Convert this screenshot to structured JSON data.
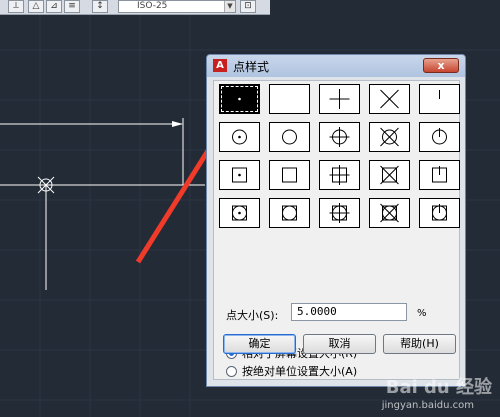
{
  "toolbar": {
    "combo_value": "ISO-25"
  },
  "dialog": {
    "title": "点样式",
    "close_label": "x",
    "styles": [
      {
        "id": "dot",
        "selected": true
      },
      {
        "id": "none",
        "selected": false
      },
      {
        "id": "plus",
        "selected": false
      },
      {
        "id": "x",
        "selected": false
      },
      {
        "id": "tick",
        "selected": false
      },
      {
        "id": "circle-dot",
        "selected": false
      },
      {
        "id": "circle",
        "selected": false
      },
      {
        "id": "circle-plus",
        "selected": false
      },
      {
        "id": "circle-x",
        "selected": false
      },
      {
        "id": "circle-tick",
        "selected": false
      },
      {
        "id": "square-dot",
        "selected": false
      },
      {
        "id": "square",
        "selected": false
      },
      {
        "id": "square-plus",
        "selected": false
      },
      {
        "id": "square-x",
        "selected": false
      },
      {
        "id": "square-tick",
        "selected": false
      },
      {
        "id": "square-circle-dot",
        "selected": false
      },
      {
        "id": "square-circle",
        "selected": false
      },
      {
        "id": "square-circle-plus",
        "selected": false
      },
      {
        "id": "square-circle-x",
        "selected": false
      },
      {
        "id": "square-circle-tick",
        "selected": false
      }
    ],
    "size_label": "点大小(S):",
    "size_value": "5.0000",
    "size_unit": "%",
    "radio_relative": "相对于屏幕设置大小(R)",
    "radio_absolute": "按绝对单位设置大小(A)",
    "relative_selected": true,
    "ok_label": "确定",
    "cancel_label": "取消",
    "help_label": "帮助(H)"
  },
  "watermark": {
    "brand": "Bai du 经验",
    "url": "jingyan.baidu.com"
  },
  "colors": {
    "canvas": "#232b36",
    "arrow": "#f03a2a",
    "lines": "#ffffff"
  }
}
